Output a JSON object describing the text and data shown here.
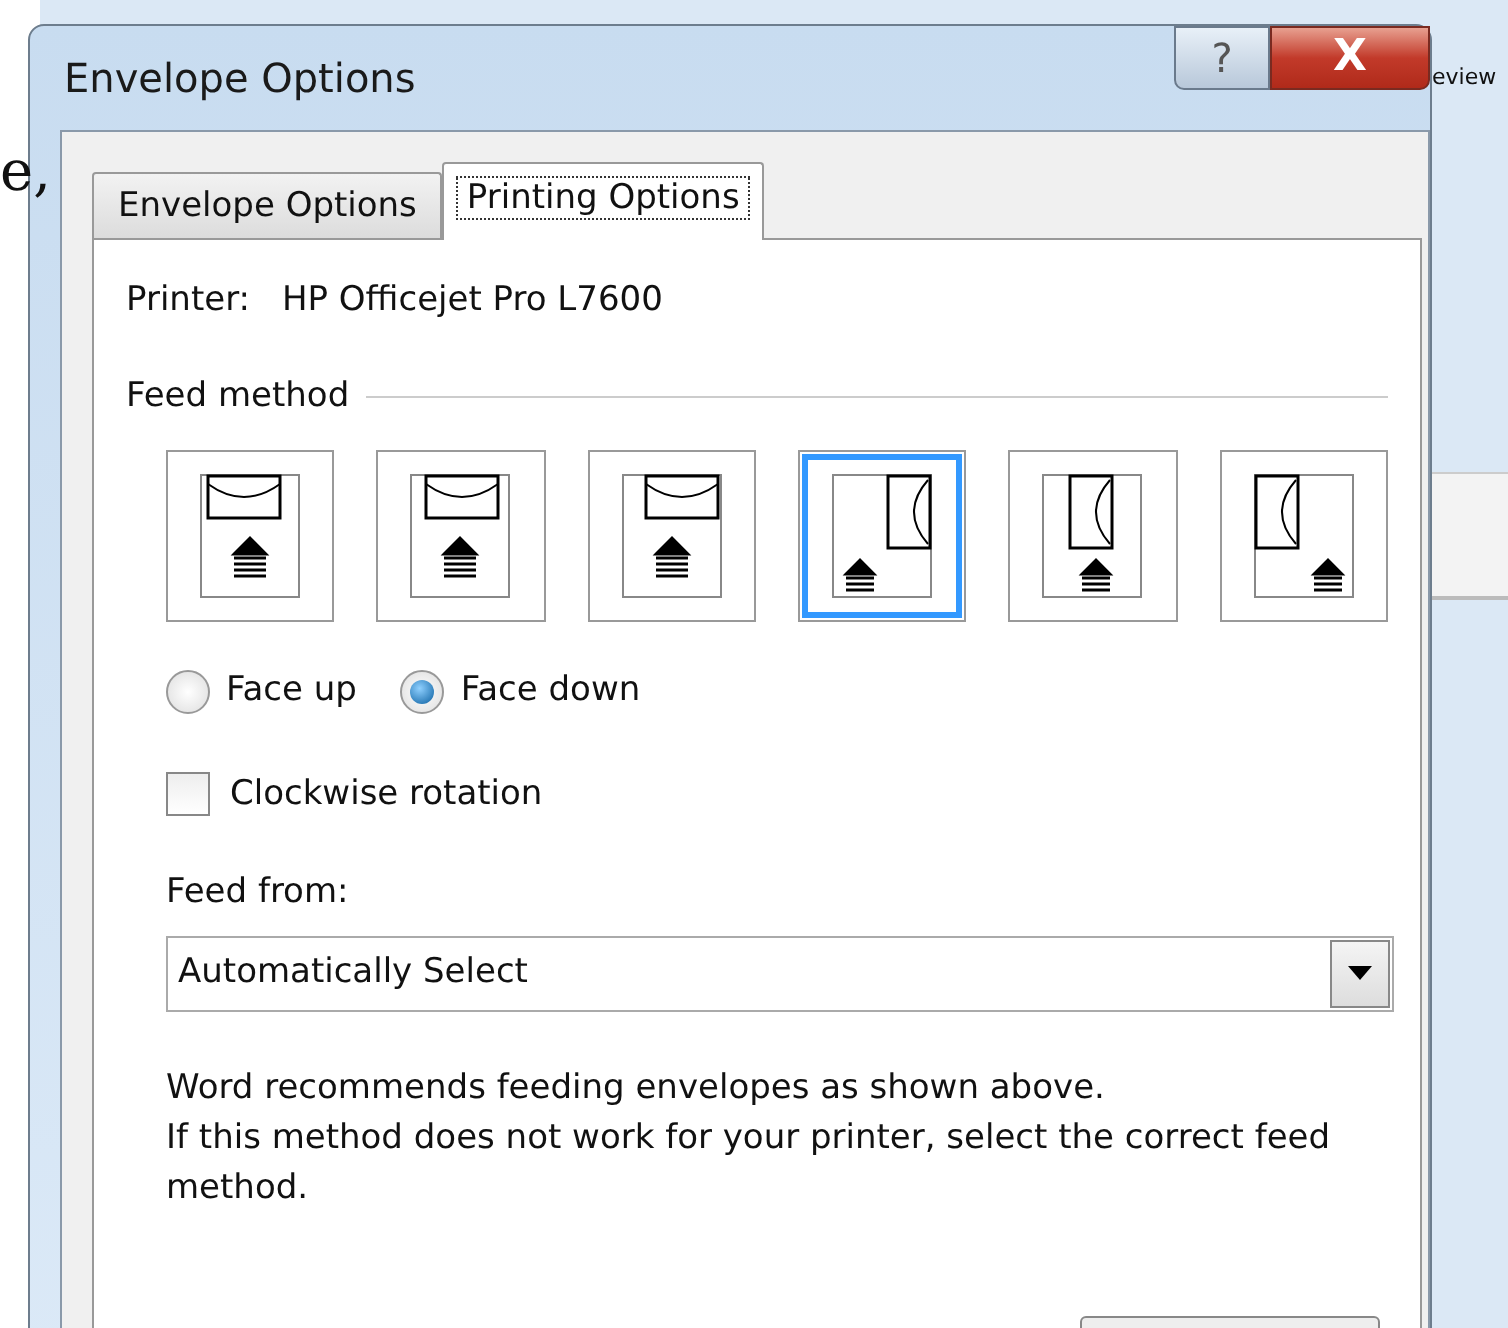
{
  "background": {
    "left_fragment": "e,",
    "right_fragment": "eview"
  },
  "window": {
    "title": "Envelope Options",
    "help": "?",
    "close": "X"
  },
  "tabs": [
    {
      "label": "Envelope Options",
      "selected": false
    },
    {
      "label": "Printing Options",
      "selected": true
    }
  ],
  "printer": {
    "label": "Printer:",
    "value": "HP Officejet Pro L7600"
  },
  "feed_method": {
    "label": "Feed method",
    "options": [
      {
        "kind": "horizontal_left",
        "selected": false
      },
      {
        "kind": "horizontal_center",
        "selected": false
      },
      {
        "kind": "horizontal_right",
        "selected": false
      },
      {
        "kind": "vertical_right",
        "selected": true
      },
      {
        "kind": "vertical_center",
        "selected": false
      },
      {
        "kind": "vertical_left",
        "selected": false
      }
    ]
  },
  "face": [
    {
      "label": "Face up",
      "selected": false
    },
    {
      "label": "Face down",
      "selected": true
    }
  ],
  "clockwise_rotation": {
    "label": "Clockwise rotation",
    "checked": false
  },
  "feed_from": {
    "label": "Feed from:",
    "value": "Automatically Select"
  },
  "note": [
    "Word recommends feeding envelopes as shown above.",
    "If this method does not work for your printer, select the correct feed method."
  ]
}
